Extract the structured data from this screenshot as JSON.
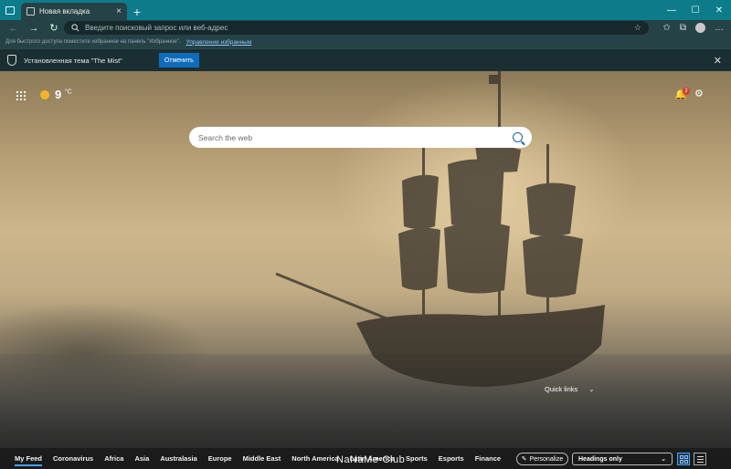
{
  "window": {
    "tab_title": "Новая вкладка",
    "tab_close": "×",
    "new_tab": "+",
    "min": "—",
    "max": "☐",
    "close": "✕"
  },
  "toolbar": {
    "back": "←",
    "forward": "→",
    "refresh": "↻",
    "address_placeholder": "Введите поисковый запрос или веб-адрес",
    "add_favorite": "☆",
    "favorites": "✩",
    "collections": "⧉",
    "more": "…"
  },
  "favbar": {
    "text": "Для быстрого доступа поместите избранное на панель \"Избранное\".",
    "link": "Управление избранным"
  },
  "infobar": {
    "message": "Установленная тема \"The Mist\"",
    "undo_label": "Отменить",
    "close": "✕"
  },
  "page": {
    "temperature": "9",
    "unit": "°C",
    "notification_count": "2",
    "bell": "🔔",
    "gear": "⚙",
    "search_placeholder": "Search the web",
    "quick_links": "Quick links",
    "quick_links_chevron": "⌄",
    "watermark": "NaNaMe-Club"
  },
  "feed": {
    "categories": [
      "My Feed",
      "Coronavirus",
      "Africa",
      "Asia",
      "Australasia",
      "Europe",
      "Middle East",
      "North America",
      "Latin America",
      "Sports",
      "Esports",
      "Finance"
    ],
    "personalize": "Personalize",
    "personalize_icon": "✎",
    "headings": "Headings only",
    "headings_chevron": "⌄"
  }
}
